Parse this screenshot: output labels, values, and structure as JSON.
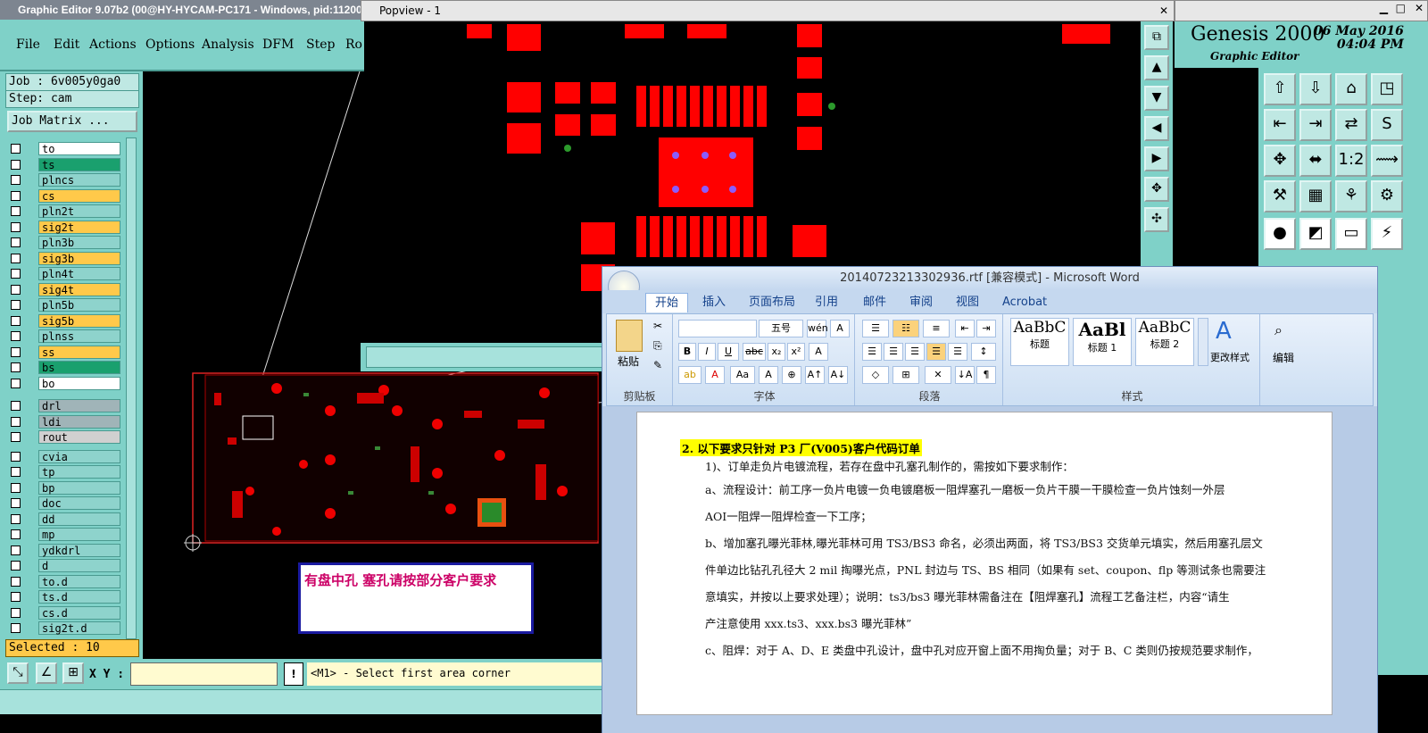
{
  "ge": {
    "title": "Graphic Editor 9.07b2 (00@HY-HYCAM-PC171 - Windows, pid:11200)",
    "menu": [
      "File",
      "Edit",
      "Actions",
      "Options",
      "Analysis",
      "DFM",
      "Step",
      "Ro"
    ],
    "job_line": "Job : 6v005y0ga0",
    "step_line": "Step: cam",
    "job_matrix": "Job Matrix ...",
    "selected": "Selected : 10",
    "xy_label": "X Y :",
    "status": "<M1> - Select first area corner"
  },
  "layers": [
    {
      "name": "to",
      "color": "#ffffff"
    },
    {
      "name": "ts",
      "color": "#1aa06e"
    },
    {
      "name": "plncs",
      "color": "#8ed3cc"
    },
    {
      "name": "cs",
      "color": "#ffc94a"
    },
    {
      "name": "pln2t",
      "color": "#8ed3cc"
    },
    {
      "name": "sig2t",
      "color": "#ffc94a"
    },
    {
      "name": "pln3b",
      "color": "#8ed3cc"
    },
    {
      "name": "sig3b",
      "color": "#ffc94a"
    },
    {
      "name": "pln4t",
      "color": "#8ed3cc"
    },
    {
      "name": "sig4t",
      "color": "#ffc94a"
    },
    {
      "name": "pln5b",
      "color": "#8ed3cc"
    },
    {
      "name": "sig5b",
      "color": "#ffc94a"
    },
    {
      "name": "plnss",
      "color": "#8ed3cc"
    },
    {
      "name": "ss",
      "color": "#ffc94a"
    },
    {
      "name": "bs",
      "color": "#1aa06e"
    },
    {
      "name": "bo",
      "color": "#ffffff"
    },
    {
      "name": "drl",
      "color": "#a0b4b8"
    },
    {
      "name": "ldi",
      "color": "#a0b4b8"
    },
    {
      "name": "rout",
      "color": "#d0d0d0"
    },
    {
      "name": "cvia",
      "color": "#8ed3cc"
    },
    {
      "name": "tp",
      "color": "#8ed3cc"
    },
    {
      "name": "bp",
      "color": "#8ed3cc"
    },
    {
      "name": "doc",
      "color": "#8ed3cc"
    },
    {
      "name": "dd",
      "color": "#8ed3cc"
    },
    {
      "name": "mp",
      "color": "#8ed3cc"
    },
    {
      "name": "ydkdrl",
      "color": "#8ed3cc"
    },
    {
      "name": "d",
      "color": "#8ed3cc"
    },
    {
      "name": "to.d",
      "color": "#8ed3cc"
    },
    {
      "name": "ts.d",
      "color": "#8ed3cc"
    },
    {
      "name": "cs.d",
      "color": "#8ed3cc"
    },
    {
      "name": "sig2t.d",
      "color": "#8ed3cc"
    }
  ],
  "popview": {
    "title": "Popview - 1"
  },
  "genesis": {
    "brand": "Genesis 2000",
    "subtitle": "Graphic Editor",
    "date": "06 May 2016",
    "time": "04:04 PM"
  },
  "callout": "有盘中孔   塞孔请按部分客户要求",
  "word": {
    "title": "20140723213302936.rtf [兼容模式] - Microsoft Word",
    "tabs": [
      "开始",
      "插入",
      "页面布局",
      "引用",
      "邮件",
      "审阅",
      "视图",
      "Acrobat"
    ],
    "font_size": "五号",
    "groups": [
      "剪贴板",
      "字体",
      "段落",
      "样式",
      "编辑"
    ],
    "paste": "粘贴",
    "styles": [
      {
        "preview": "AaBbC",
        "name": "标题"
      },
      {
        "preview": "AaBl",
        "name": "标题 1"
      },
      {
        "preview": "AaBbC",
        "name": "标题 2"
      }
    ],
    "change_styles": "更改样式",
    "edit": "编辑",
    "lines": [
      "2.  以下要求只针对 P3 厂(V005)客户代码订单",
      "1)、订单走负片电镀流程，若存在盘中孔塞孔制作的，需按如下要求制作：",
      "a、流程设计：前工序一负片电镀一负电镀磨板一阻焊塞孔一磨板一负片干膜一干膜检查一负片蚀刻一外层",
      "AOI一阻焊一阻焊检查一下工序；",
      "b、增加塞孔曝光菲林,曝光菲林可用 TS3/BS3 命名，必须出两面，将 TS3/BS3 交货单元填实，然后用塞孔层文",
      "件单边比钻孔孔径大 2  mil 掏曝光点，PNL 封边与 TS、BS 相同（如果有 set、coupon、flp 等测试条也需要注",
      "意填实，并按以上要求处理）；说明：ts3/bs3 曝光菲林需备注在【阻焊塞孔】流程工艺备注栏，内容“请生",
      "产注意使用 xxx.ts3、xxx.bs3 曝光菲林”",
      "c、阻焊：对于 A、D、E 类盘中孔设计，盘中孔对应开窗上面不用掏负量；对于 B、C 类则仍按规范要求制作，"
    ]
  }
}
